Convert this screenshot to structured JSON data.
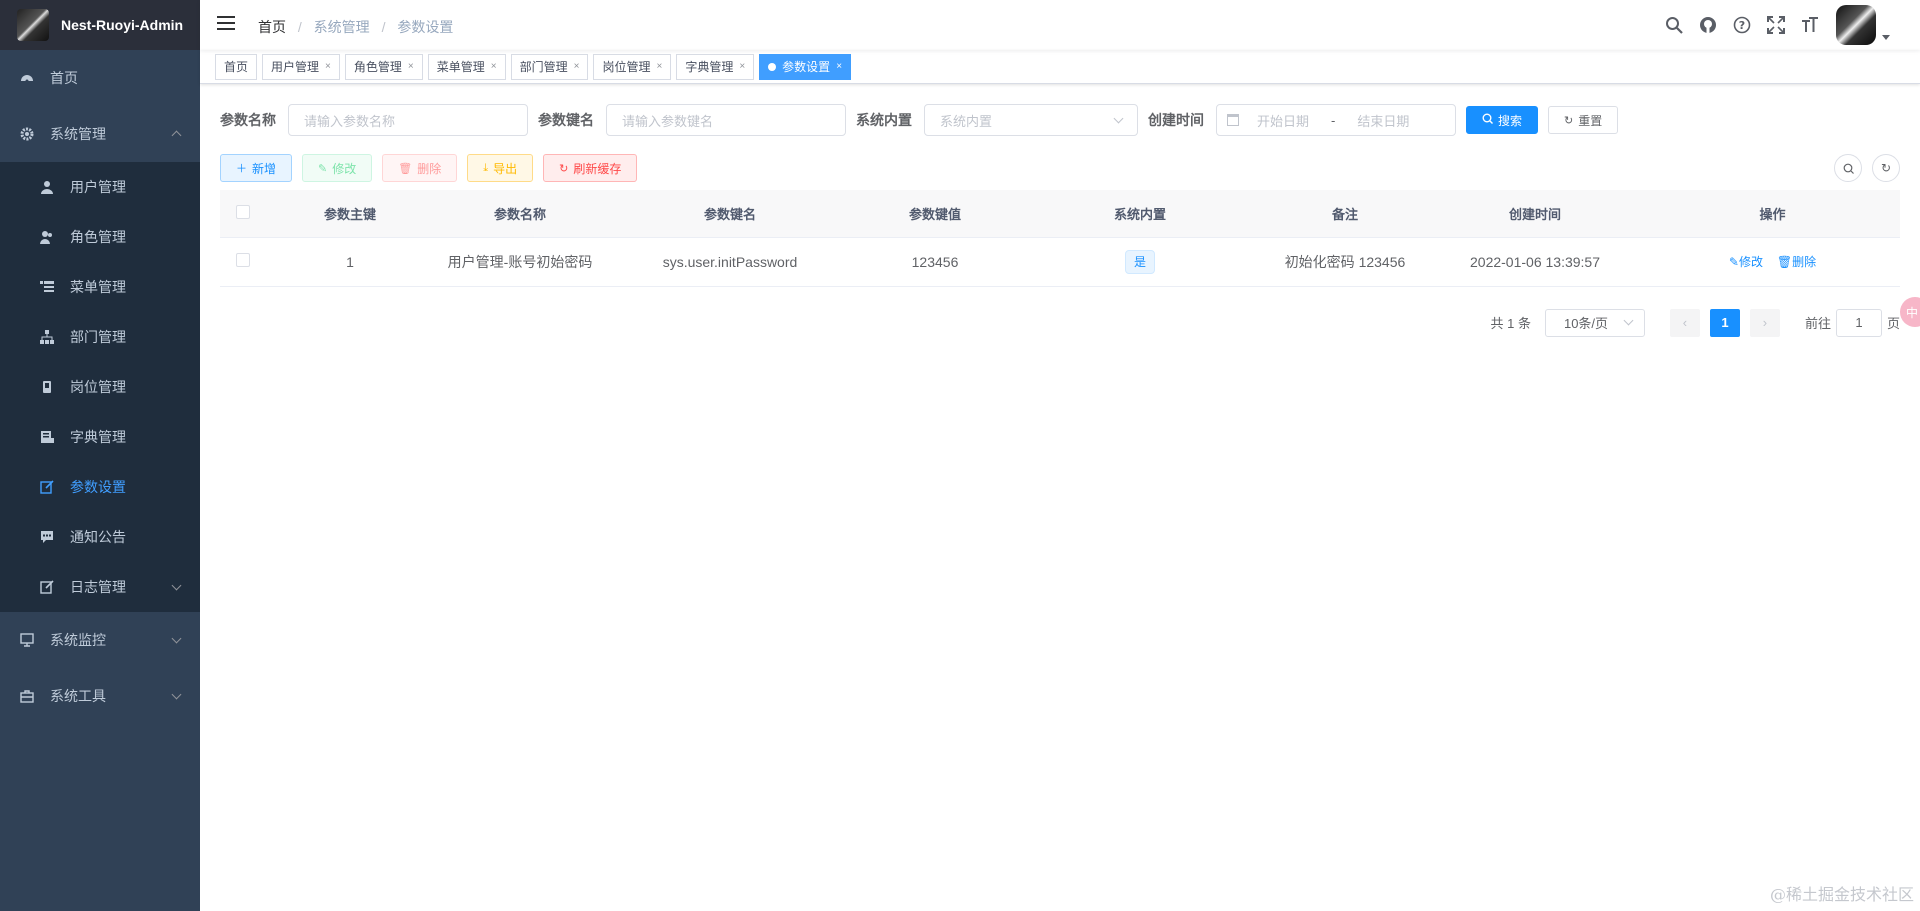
{
  "app": {
    "title": "Nest-Ruoyi-Admin"
  },
  "sidebar": {
    "items": [
      {
        "label": "首页"
      },
      {
        "label": "系统管理"
      },
      {
        "label": "系统监控"
      },
      {
        "label": "系统工具"
      }
    ],
    "system_children": [
      {
        "label": "用户管理"
      },
      {
        "label": "角色管理"
      },
      {
        "label": "菜单管理"
      },
      {
        "label": "部门管理"
      },
      {
        "label": "岗位管理"
      },
      {
        "label": "字典管理"
      },
      {
        "label": "参数设置"
      },
      {
        "label": "通知公告"
      },
      {
        "label": "日志管理"
      }
    ]
  },
  "breadcrumb": {
    "home": "首页",
    "level1": "系统管理",
    "level2": "参数设置",
    "sep": "/"
  },
  "tags": [
    {
      "label": "首页"
    },
    {
      "label": "用户管理"
    },
    {
      "label": "角色管理"
    },
    {
      "label": "菜单管理"
    },
    {
      "label": "部门管理"
    },
    {
      "label": "岗位管理"
    },
    {
      "label": "字典管理"
    },
    {
      "label": "参数设置"
    }
  ],
  "search": {
    "config_name_label": "参数名称",
    "config_name_placeholder": "请输入参数名称",
    "config_key_label": "参数键名",
    "config_key_placeholder": "请输入参数键名",
    "config_type_label": "系统内置",
    "config_type_placeholder": "系统内置",
    "create_time_label": "创建时间",
    "start_placeholder": "开始日期",
    "end_placeholder": "结束日期",
    "range_sep": "-",
    "search_btn": "搜索",
    "reset_btn": "重置"
  },
  "toolbar": {
    "add": "新增",
    "edit": "修改",
    "delete": "删除",
    "export": "导出",
    "refresh_cache": "刷新缓存"
  },
  "table": {
    "headers": [
      "参数主键",
      "参数名称",
      "参数键名",
      "参数键值",
      "系统内置",
      "备注",
      "创建时间",
      "操作"
    ],
    "rows": [
      {
        "id": "1",
        "name": "用户管理-账号初始密码",
        "key": "sys.user.initPassword",
        "value": "123456",
        "builtin": "是",
        "remark": "初始化密码 123456",
        "create_time": "2022-01-06 13:39:57",
        "edit": "修改",
        "delete": "删除"
      }
    ]
  },
  "pagination": {
    "total": "共 1 条",
    "page_size": "10条/页",
    "current": "1",
    "goto_prefix": "前往",
    "goto_value": "1",
    "goto_suffix": "页"
  },
  "float_badge": "中",
  "watermark": "@稀土掘金技术社区",
  "colors": {
    "sidebar_bg": "#304156",
    "primary": "#1890ff",
    "active_tag": "#409eff"
  }
}
